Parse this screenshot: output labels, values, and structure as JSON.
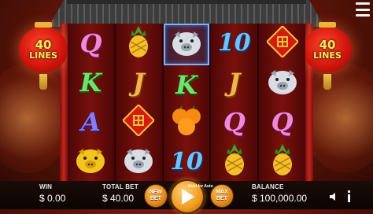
{
  "lanterns": {
    "left": {
      "number": "40",
      "label": "LINES"
    },
    "right": {
      "number": "40",
      "label": "LINES"
    }
  },
  "reels": [
    [
      "letter-q",
      "letter-k",
      "letter-a",
      "golden-pig"
    ],
    [
      "pineapple",
      "letter-j",
      "fortune-card",
      "silver-pig"
    ],
    [
      "silver-pig-highlight",
      "letter-k",
      "oranges",
      "ten"
    ],
    [
      "ten",
      "letter-j",
      "letter-q",
      "pineapple"
    ],
    [
      "fortune-card",
      "silver-pig",
      "letter-q",
      "pineapple"
    ]
  ],
  "symbols": {
    "letter-q": "Q",
    "letter-k": "K",
    "letter-j": "J",
    "letter-a": "A",
    "ten": "10"
  },
  "bottom": {
    "win_label": "WIN",
    "win_value": "$ 0.00",
    "bet_label": "TOTAL BET",
    "bet_value": "$ 40.00",
    "new_bet_line1": "NEW",
    "new_bet_line2": "BET",
    "spin_hint": "Hold for Auto",
    "max_bet_line1": "MAX",
    "max_bet_line2": "BET",
    "balance_label": "BALANCE",
    "balance_value": "$ 100,000.00"
  },
  "colors": {
    "pillar_red": "#c4281e",
    "lantern_text": "#ffe25a",
    "button_orange": "#f0991e"
  }
}
